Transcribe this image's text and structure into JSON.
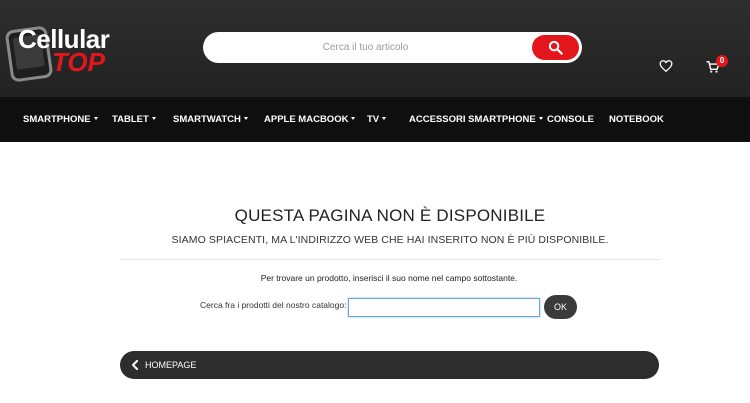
{
  "header": {
    "logo_line1": "Cellular",
    "logo_line2": "TOP",
    "search_placeholder": "Cerca il tuo articolo",
    "cart_count": "0"
  },
  "nav": {
    "items": [
      {
        "label": "SMARTPHONE",
        "has_dropdown": true
      },
      {
        "label": "TABLET",
        "has_dropdown": true
      },
      {
        "label": "SMARTWATCH",
        "has_dropdown": true
      },
      {
        "label": "APPLE MACBOOK",
        "has_dropdown": true
      },
      {
        "label": "TV",
        "has_dropdown": true
      },
      {
        "label": "ACCESSORI SMARTPHONE",
        "has_dropdown": true
      },
      {
        "label": "CONSOLE",
        "has_dropdown": false
      },
      {
        "label": "NOTEBOOK",
        "has_dropdown": false
      }
    ]
  },
  "content": {
    "title": "QUESTA PAGINA NON È DISPONIBILE",
    "subtitle": "SIAMO SPIACENTI, MA L'INDIRIZZO WEB CHE HAI INSERITO NON È PIÙ DISPONIBILE.",
    "hint": "Per trovare un prodotto, inserisci il suo nome nel campo sottostante.",
    "search_label": "Cerca fra i prodotti del nostro catalogo:",
    "search_value": "",
    "ok_label": "OK",
    "homepage_label": "HOMEPAGE"
  },
  "colors": {
    "accent": "#e3161b",
    "header_bg": "#2a2a2a",
    "nav_bg": "#0f0f0f"
  },
  "icons": {
    "search": "search-icon",
    "wishlist": "heart-icon",
    "cart": "cart-icon",
    "back": "chevron-left-icon"
  }
}
